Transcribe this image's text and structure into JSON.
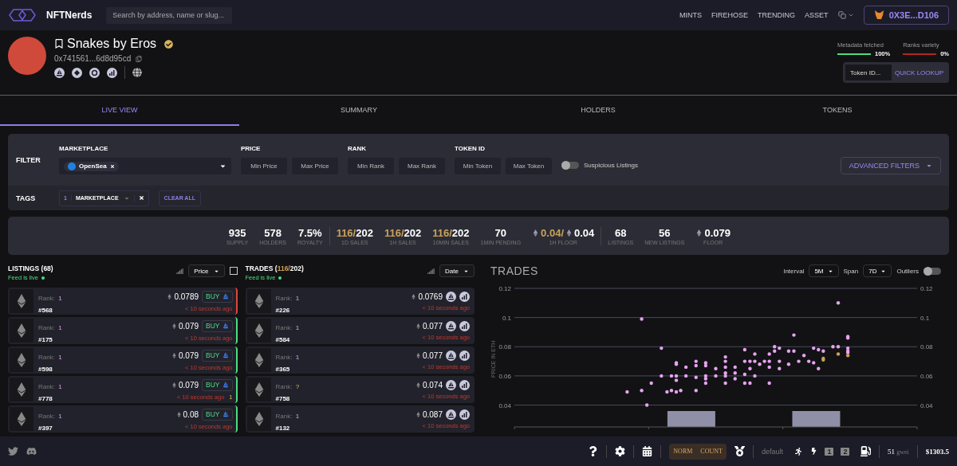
{
  "nav": {
    "brand": "NFTNerds",
    "search": {
      "placeholder": "Search by address, name or slug..."
    },
    "links": [
      "MINTS",
      "FIREHOSE",
      "TRENDING",
      "ASSET"
    ],
    "wallet": "0X3E...D106"
  },
  "collection": {
    "name": "Snakes by Eros",
    "verified": true,
    "address": "0x741561...6d8d95cd"
  },
  "metrics": [
    {
      "label": "Metadata fetched",
      "value": "100%",
      "level": 1,
      "color": "#4ade80"
    },
    {
      "label": "Ranks variety",
      "value": "0%",
      "level": 0,
      "color": "#b3261e"
    }
  ],
  "lookup": {
    "placeholder": "Token ID...",
    "button": "QUICK LOOKUP"
  },
  "tabs": [
    {
      "label": "LIVE VIEW",
      "selected": true
    },
    {
      "label": "SUMMARY",
      "selected": false
    },
    {
      "label": "HOLDERS",
      "selected": false
    },
    {
      "label": "TOKENS",
      "selected": false
    }
  ],
  "filter": {
    "label": "FILTER",
    "marketplace": {
      "label": "MARKETPLACE",
      "chip": "OpenSea"
    },
    "ranges": [
      {
        "label": "PRICE",
        "fields": [
          {
            "placeholder": "Min Price"
          },
          {
            "placeholder": "Max Price"
          }
        ]
      },
      {
        "label": "RANK",
        "fields": [
          {
            "placeholder": "Min Rank"
          },
          {
            "placeholder": "Max Rank"
          }
        ]
      },
      {
        "label": "TOKEN ID",
        "fields": [
          {
            "placeholder": "Min Token"
          },
          {
            "placeholder": "Max Token"
          }
        ]
      }
    ],
    "suspicious": {
      "label": "Suspicious Listings",
      "on": false
    },
    "advanced": "ADVANCED FILTERS"
  },
  "tags": {
    "label": "TAGS",
    "tag": {
      "count": "1",
      "label": "MARKETPLACE"
    },
    "clear": "CLEAR ALL"
  },
  "stats": [
    [
      {
        "kind": "plain",
        "value": "935",
        "label": "SUPPLY"
      },
      {
        "kind": "plain",
        "value": "578",
        "label": "HOLDERS"
      },
      {
        "kind": "plain",
        "value": "7.5%",
        "label": "ROYALTY"
      }
    ],
    [
      {
        "kind": "split",
        "accent": "116/",
        "value": "202",
        "label": "1D SALES"
      },
      {
        "kind": "split",
        "accent": "116/",
        "value": "202",
        "label": "1H SALES"
      },
      {
        "kind": "split",
        "accent": "116/",
        "value": "202",
        "label": "10MIN SALES"
      },
      {
        "kind": "plain",
        "value": "70",
        "label": "1MIN PENDING"
      },
      {
        "kind": "eth_split",
        "accent": "0.04/",
        "value": "0.04",
        "label": "1H FLOOR"
      }
    ],
    [
      {
        "kind": "plain",
        "value": "68",
        "label": "LISTINGS"
      },
      {
        "kind": "plain",
        "value": "56",
        "label": "NEW LISTINGS"
      },
      {
        "kind": "eth",
        "value": "0.079",
        "label": "FLOOR"
      }
    ]
  ],
  "listings": {
    "title": "LISTINGS (68)",
    "live": "Feed is live",
    "sort": "Price",
    "sort_checked": false,
    "rows": [
      {
        "rank_label": "Rank:",
        "rank": "1",
        "token": "#568",
        "price": "0.0789",
        "buy": "BUY",
        "time": "< 10 seconds ago",
        "color": "#e0443a"
      },
      {
        "rank_label": "Rank:",
        "rank": "1",
        "token": "#175",
        "price": "0.079",
        "buy": "BUY",
        "time": "< 10 seconds ago",
        "color": "#4ade80"
      },
      {
        "rank_label": "Rank:",
        "rank": "1",
        "token": "#598",
        "price": "0.079",
        "buy": "BUY",
        "time": "< 10 seconds ago",
        "color": "#4ade80"
      },
      {
        "rank_label": "Rank:",
        "rank": "1",
        "token": "#778",
        "price": "0.079",
        "buy": "BUY",
        "time": "< 10 seconds ago",
        "extra": "1",
        "color": "#4ade80"
      },
      {
        "rank_label": "Rank:",
        "rank": "1",
        "token": "#397",
        "price": "0.08",
        "buy": "BUY",
        "time": "< 10 seconds ago",
        "color": "#4ade80"
      }
    ]
  },
  "trades": {
    "title": "TRADES (",
    "accent": "116/",
    "rest": "202)",
    "live": "Feed is live",
    "sort": "Date",
    "rows": [
      {
        "rank_label": "Rank:",
        "rank": "1",
        "kind": "ranked",
        "token": "#226",
        "price": "0.0769",
        "time": "< 10 seconds ago"
      },
      {
        "rank_label": "Rank:",
        "rank": "1",
        "kind": "ranked",
        "token": "#584",
        "price": "0.077",
        "time": "< 10 seconds ago"
      },
      {
        "rank_label": "Rank:",
        "rank": "1",
        "kind": "ranked",
        "token": "#365",
        "price": "0.077",
        "time": "< 10 seconds ago"
      },
      {
        "rank_label": "Rank:",
        "rank": "?",
        "kind": "unranked",
        "token": "#758",
        "price": "0.074",
        "time": "< 10 seconds ago"
      },
      {
        "rank_label": "Rank:",
        "rank": "1",
        "kind": "ranked",
        "token": "#132",
        "price": "0.087",
        "time": "< 10 seconds ago"
      }
    ]
  },
  "chart_panel": {
    "title": "TRADES",
    "interval_label": "Interval",
    "interval": "5M",
    "span_label": "Span",
    "span": "7D",
    "outliers_label": "Outliers",
    "outliers_on": false,
    "y_axis_title": "PRICE IN ETH",
    "left_axis_labels": [
      "0.12",
      "0.1",
      "0.08",
      "0.06",
      "0.04"
    ],
    "right_axis_labels": [
      "0.12",
      "0.1",
      "0.08",
      "0.06",
      "0.04"
    ]
  },
  "footer": {
    "mode_left": "NORM",
    "mode_right": "COUNT",
    "profile": "default",
    "speed_keys": [
      "1",
      "2"
    ],
    "gas": "51",
    "gas_unit": "gwei",
    "eth_price": "$1303.5"
  }
}
